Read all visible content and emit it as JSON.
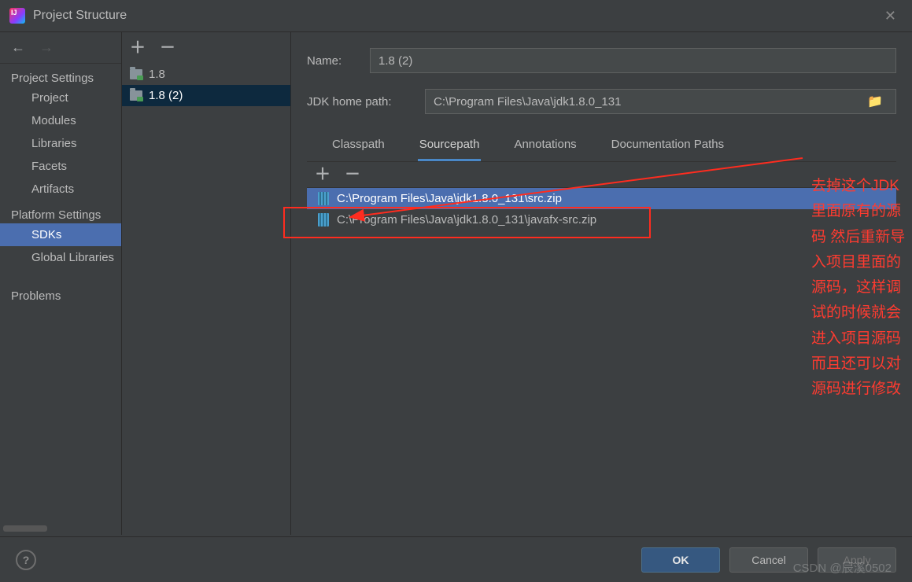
{
  "window": {
    "title": "Project Structure"
  },
  "nav": {
    "group_project": "Project Settings",
    "items_project": [
      "Project",
      "Modules",
      "Libraries",
      "Facets",
      "Artifacts"
    ],
    "group_platform": "Platform Settings",
    "items_platform": [
      "SDKs",
      "Global Libraries"
    ],
    "problems": "Problems",
    "selected": "SDKs"
  },
  "sdk_list": {
    "items": [
      {
        "label": "1.8"
      },
      {
        "label": "1.8 (2)"
      }
    ],
    "selected_index": 1
  },
  "form": {
    "name_label": "Name:",
    "name_value": "1.8 (2)",
    "home_label": "JDK home path:",
    "home_value": "C:\\Program Files\\Java\\jdk1.8.0_131"
  },
  "tabs": {
    "items": [
      "Classpath",
      "Sourcepath",
      "Annotations",
      "Documentation Paths"
    ],
    "active_index": 1
  },
  "src_rows": [
    "C:\\Program Files\\Java\\jdk1.8.0_131\\src.zip",
    "C:\\Program Files\\Java\\jdk1.8.0_131\\javafx-src.zip"
  ],
  "buttons": {
    "ok": "OK",
    "cancel": "Cancel",
    "apply": "Apply"
  },
  "annotation": {
    "text": "去掉这个JDK里面原有的源码 然后重新导入项目里面的源码，这样调试的时候就会进入项目源码 而且还可以对源码进行修改"
  },
  "watermark": "CSDN @辰溪0502"
}
